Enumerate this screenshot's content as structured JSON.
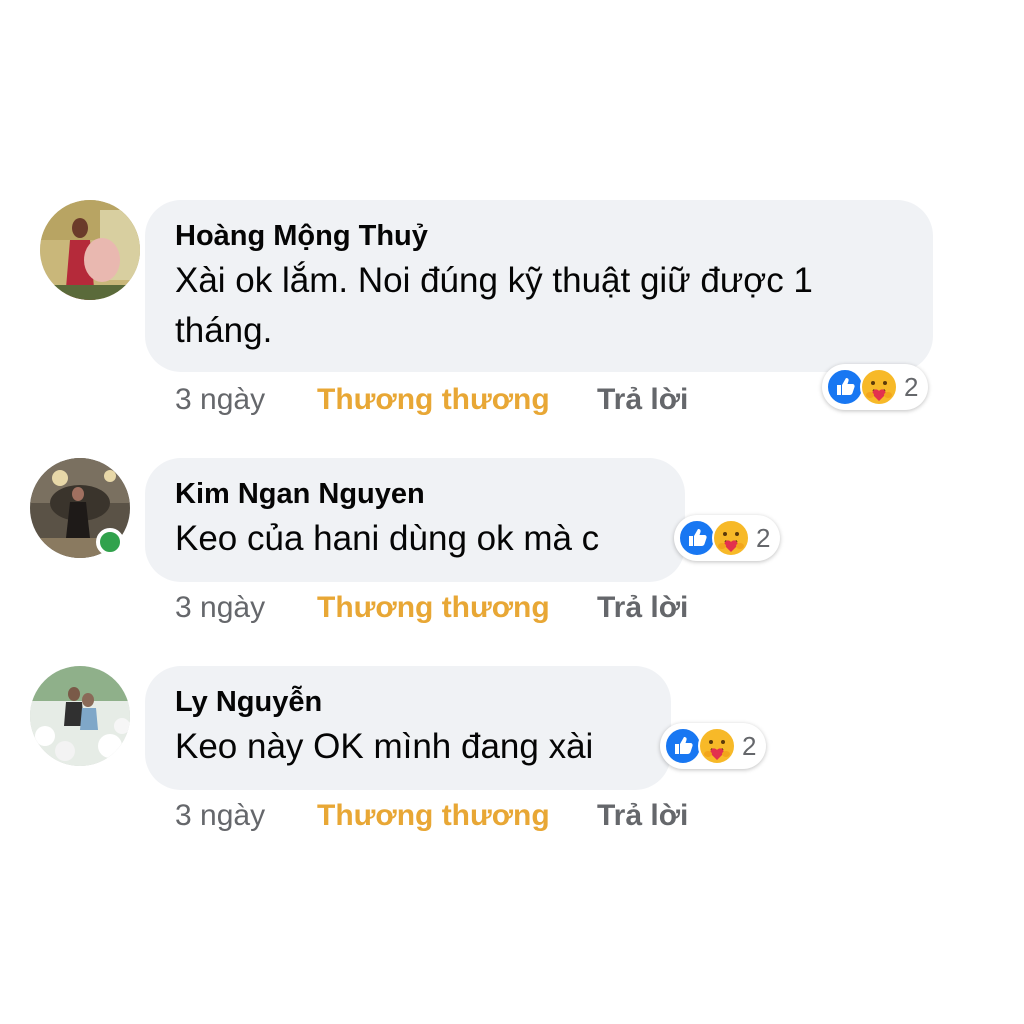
{
  "comments": [
    {
      "author": "Hoàng Mộng Thuỷ",
      "text": "Xài ok lắm. Noi đúng kỹ thuật giữ được  1 tháng.",
      "time": "3 ngày",
      "reaction_label": "Thương thương",
      "reply_label": "Trả lời",
      "reaction_icons": [
        "like-icon",
        "care-icon"
      ],
      "reaction_count": "2",
      "online": false
    },
    {
      "author": "Kim Ngan Nguyen",
      "text": "Keo của hani dùng ok mà c",
      "time": "3 ngày",
      "reaction_label": "Thương thương",
      "reply_label": "Trả lời",
      "reaction_icons": [
        "like-icon",
        "care-icon"
      ],
      "reaction_count": "2",
      "online": true
    },
    {
      "author": "Ly Nguyễn",
      "text": "Keo này OK mình đang xài",
      "time": "3 ngày",
      "reaction_label": "Thương thương",
      "reply_label": "Trả lời",
      "reaction_icons": [
        "like-icon",
        "care-icon"
      ],
      "reaction_count": "2",
      "online": false
    }
  ],
  "colors": {
    "bubble": "#f0f2f5",
    "reaction_label": "#e8a735",
    "meta_text": "#65676b",
    "like_blue": "#1877f2",
    "online_green": "#31a24c"
  }
}
